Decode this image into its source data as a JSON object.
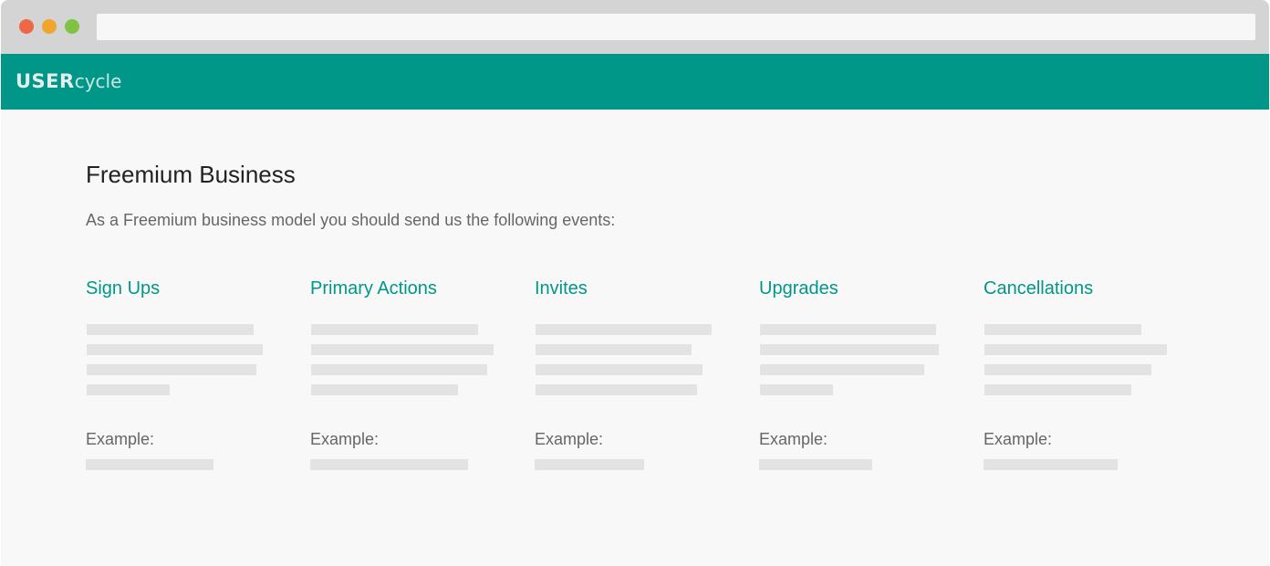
{
  "browser": {
    "window_controls": [
      "close",
      "minimize",
      "maximize"
    ],
    "address_value": ""
  },
  "app": {
    "logo_bold": "USER",
    "logo_light": "cycle",
    "brand_color": "#009788"
  },
  "page": {
    "title": "Freemium Business",
    "subtitle": "As a Freemium business model you should send us the following events:"
  },
  "events": [
    {
      "heading": "Sign Ups",
      "example_label": "Example:"
    },
    {
      "heading": "Primary Actions",
      "example_label": "Example:"
    },
    {
      "heading": "Invites",
      "example_label": "Example:"
    },
    {
      "heading": "Upgrades",
      "example_label": "Example:"
    },
    {
      "heading": "Cancellations",
      "example_label": "Example:"
    }
  ]
}
